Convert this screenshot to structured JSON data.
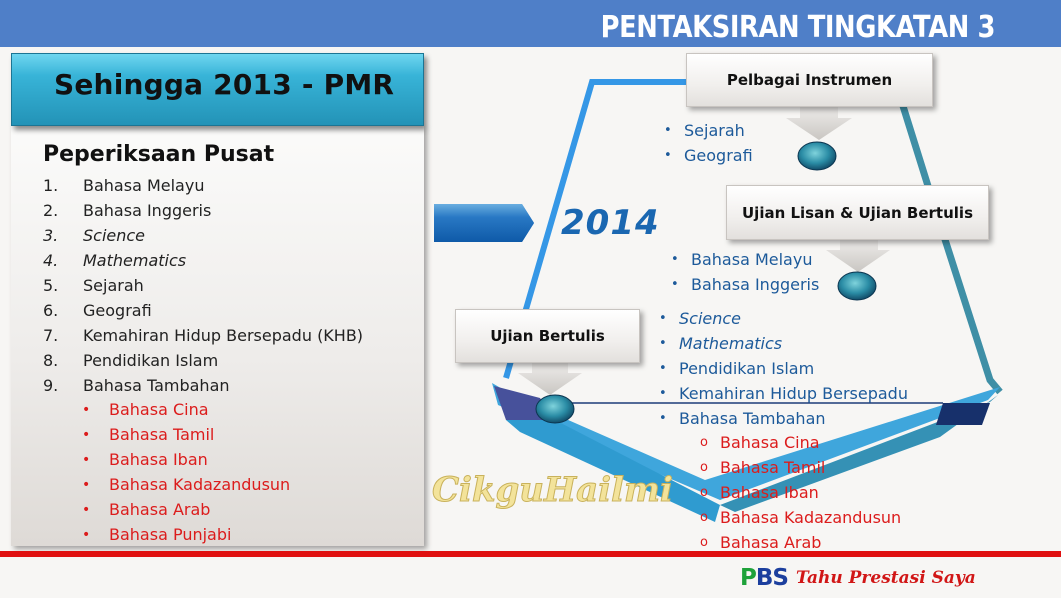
{
  "slide": {
    "title": "PENTAKSIRAN TINGKATAN 3",
    "colors": {
      "band": "#4f7fc8",
      "red_rule": "#e01010",
      "blue_text": "#1d5a9a",
      "red_text": "#dc1c1c",
      "year": "#1a67b1"
    }
  },
  "left": {
    "header": "Sehingga 2013 - PMR",
    "section_title": "Peperiksaan Pusat",
    "items": [
      {
        "num": "1.",
        "label": "Bahasa Melayu",
        "italic": false
      },
      {
        "num": "2.",
        "label": "Bahasa Inggeris",
        "italic": false
      },
      {
        "num": "3.",
        "label": "Science",
        "italic": true
      },
      {
        "num": "4.",
        "label": "Mathematics",
        "italic": true
      },
      {
        "num": "5.",
        "label": "Sejarah",
        "italic": false
      },
      {
        "num": "6.",
        "label": "Geografi",
        "italic": false
      },
      {
        "num": "7.",
        "label": "Kemahiran Hidup Bersepadu (KHB)",
        "italic": false
      },
      {
        "num": "8.",
        "label": "Pendidikan Islam",
        "italic": false
      },
      {
        "num": "9.",
        "label": "Bahasa Tambahan",
        "italic": false
      }
    ],
    "bullet": "•",
    "sub_items": [
      "Bahasa Cina",
      "Bahasa Tamil",
      "Bahasa Iban",
      "Bahasa Kadazandusun",
      "Bahasa Arab",
      "Bahasa Punjabi"
    ]
  },
  "right": {
    "year": "2014",
    "callouts": [
      "Pelbagai Instrumen",
      "Ujian Lisan & Ujian Bertulis",
      "Ujian Bertulis"
    ],
    "bullet": "•",
    "sub_bullet": "o",
    "group_instrumen": [
      "Sejarah",
      "Geografi"
    ],
    "group_lisan": [
      "Bahasa Melayu",
      "Bahasa Inggeris"
    ],
    "group_bertulis": [
      {
        "label": "Science",
        "italic": true
      },
      {
        "label": "Mathematics",
        "italic": true
      },
      {
        "label": "Pendidikan Islam",
        "italic": false
      },
      {
        "label": "Kemahiran Hidup Bersepadu",
        "italic": false
      },
      {
        "label": "Bahasa Tambahan",
        "italic": false
      }
    ],
    "group_tambahan": [
      "Bahasa Cina",
      "Bahasa Tamil",
      "Bahasa Iban",
      "Bahasa Kadazandusun",
      "Bahasa Arab"
    ]
  },
  "watermark": "CikguHailmi",
  "footer": {
    "logo_letters": [
      "P",
      "B",
      "S"
    ],
    "tagline": "Tahu Prestasi Saya"
  }
}
